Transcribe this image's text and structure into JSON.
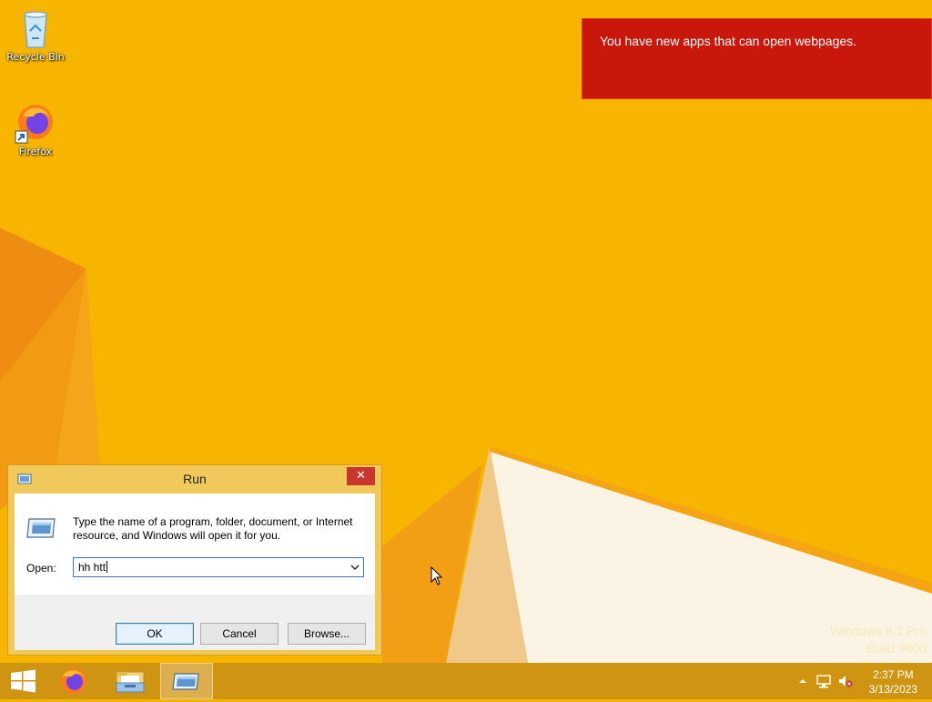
{
  "desktop": {
    "icons": [
      {
        "label": "Recycle Bin",
        "icon": "recycle-bin-icon"
      },
      {
        "label": "Firefox",
        "icon": "firefox-icon"
      }
    ],
    "watermark": {
      "line1": "Windows 8.1 Pro",
      "line2": "Build 9600"
    }
  },
  "toast": {
    "message": "You have new apps that can open webpages."
  },
  "run_dialog": {
    "title": "Run",
    "close_label": "✕",
    "description": "Type the name of a program, folder, document, or Internet resource, and Windows will open it for you.",
    "open_label": "Open:",
    "open_value": "hh htt",
    "ok_label": "OK",
    "cancel_label": "Cancel",
    "browse_label": "Browse..."
  },
  "taskbar": {
    "buttons": [
      {
        "icon": "windows-start-icon"
      },
      {
        "icon": "firefox-icon"
      },
      {
        "icon": "file-explorer-icon"
      },
      {
        "icon": "run-icon",
        "active": true
      }
    ],
    "tray": {
      "icons": [
        "chevron-up-icon",
        "network-icon",
        "volume-muted-icon"
      ],
      "time": "2:37 PM",
      "date": "3/13/2023"
    }
  },
  "colors": {
    "wallpaper": "#f5b301",
    "toast": "#c9170c",
    "taskbar": "#cf9512",
    "dialog_frame": "#f1c85a",
    "close_button": "#c7372e"
  }
}
